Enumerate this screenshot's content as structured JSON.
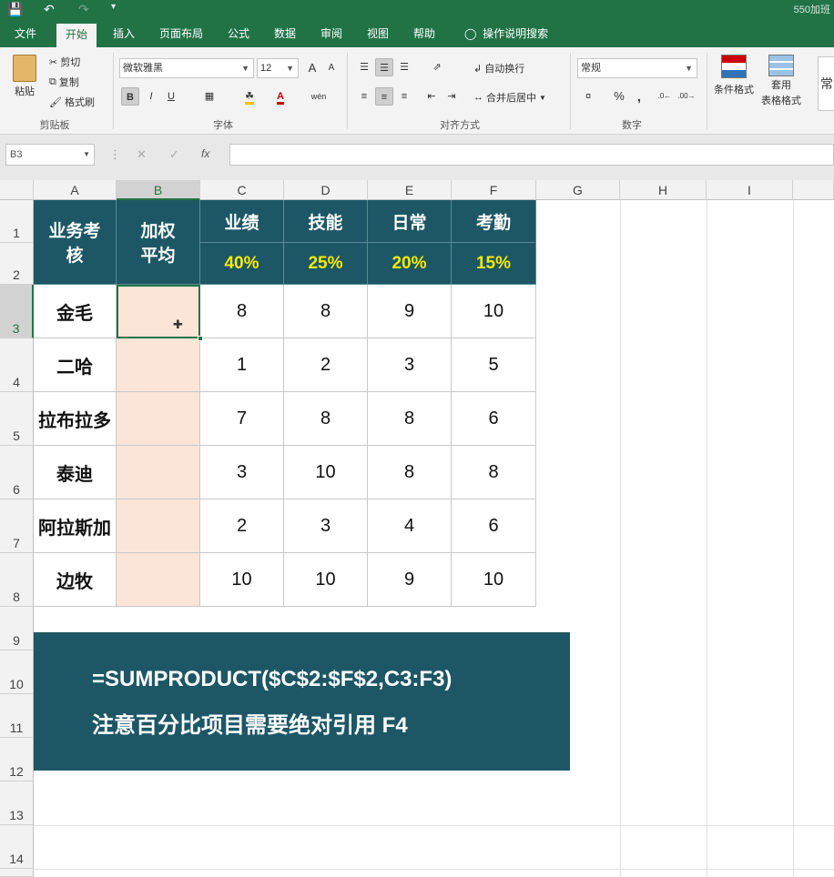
{
  "window": {
    "doc_title": "550加班"
  },
  "tabs": [
    "文件",
    "开始",
    "插入",
    "页面布局",
    "公式",
    "数据",
    "审阅",
    "视图",
    "帮助"
  ],
  "search_label": "操作说明搜索",
  "clipboard": {
    "paste": "粘贴",
    "cut": "剪切",
    "copy": "复制",
    "format_painter": "格式刷",
    "group": "剪贴板"
  },
  "font": {
    "name": "微软雅黑",
    "size": "12",
    "group": "字体",
    "bold": "B",
    "italic": "I",
    "underline": "U",
    "grow": "A",
    "shrink": "A",
    "phonetic": "wén"
  },
  "align": {
    "wrap": "自动换行",
    "merge": "合并后居中",
    "group": "对齐方式"
  },
  "number": {
    "format": "常规",
    "group": "数字",
    "percent": "%",
    "comma": ","
  },
  "styles": {
    "conditional": "条件格式",
    "table1": "套用",
    "table2": "表格格式",
    "cell_style": "常"
  },
  "formula_bar": {
    "name_box": "B3",
    "fx": "fx",
    "value": ""
  },
  "columns": [
    "A",
    "B",
    "C",
    "D",
    "E",
    "F",
    "G",
    "H",
    "I"
  ],
  "rows": [
    "1",
    "2",
    "3",
    "4",
    "5",
    "6",
    "7",
    "8",
    "9",
    "10",
    "11",
    "12",
    "13",
    "14"
  ],
  "table": {
    "header_a": [
      "业务考",
      "核"
    ],
    "header_b": [
      "加权",
      "平均"
    ],
    "categories": [
      "业绩",
      "技能",
      "日常",
      "考勤"
    ],
    "weights": [
      "40%",
      "25%",
      "20%",
      "15%"
    ],
    "records": [
      {
        "name": "金毛",
        "scores": [
          "8",
          "8",
          "9",
          "10"
        ]
      },
      {
        "name": "二哈",
        "scores": [
          "1",
          "2",
          "3",
          "5"
        ]
      },
      {
        "name": "拉布拉多",
        "scores": [
          "7",
          "8",
          "8",
          "6"
        ]
      },
      {
        "name": "泰迪",
        "scores": [
          "3",
          "10",
          "8",
          "8"
        ]
      },
      {
        "name": "阿拉斯加",
        "scores": [
          "2",
          "3",
          "4",
          "6"
        ]
      },
      {
        "name": "边牧",
        "scores": [
          "10",
          "10",
          "9",
          "10"
        ]
      }
    ]
  },
  "note": {
    "formula": "=SUMPRODUCT($C$2:$F$2,C3:F3)",
    "tip": "注意百分比项目需要绝对引用   F4"
  },
  "colors": {
    "ribbon_green": "#217346",
    "header_teal": "#1d5766",
    "weight_yellow": "#f5ea00",
    "weighted_fill": "#fbe5d6"
  }
}
